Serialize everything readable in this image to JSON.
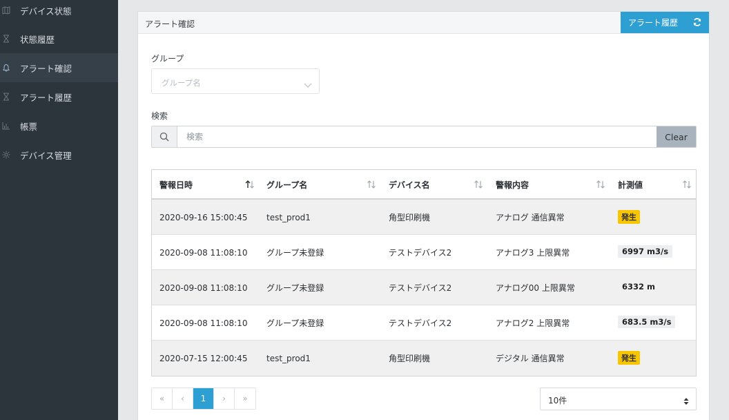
{
  "sidebar": {
    "items": [
      {
        "label": "デバイス状態",
        "icon": "map-icon"
      },
      {
        "label": "状態履歴",
        "icon": "hourglass-icon"
      },
      {
        "label": "アラート確認",
        "icon": "bell-icon",
        "active": true
      },
      {
        "label": "アラート履歴",
        "icon": "hourglass-icon"
      },
      {
        "label": "帳票",
        "icon": "bar-chart-icon"
      },
      {
        "label": "デバイス管理",
        "icon": "gear-icon"
      }
    ]
  },
  "panel": {
    "title": "アラート確認",
    "history_button": "アラート履歴"
  },
  "filters": {
    "group_label": "グループ",
    "group_placeholder": "グループ名",
    "search_label": "検索",
    "search_placeholder": "検索",
    "search_value": "",
    "clear_label": "Clear"
  },
  "table": {
    "columns": [
      "警報日時",
      "グループ名",
      "デバイス名",
      "警報内容",
      "計測値"
    ],
    "rows": [
      {
        "time": "2020-09-16 15:00:45",
        "group": "test_prod1",
        "device": "角型印刷機",
        "alert": "アナログ 通信異常",
        "value": "発生",
        "value_style": "yellow"
      },
      {
        "time": "2020-09-08 11:08:10",
        "group": "グループ未登録",
        "device": "テストデバイス2",
        "alert": "アナログ3 上限異常",
        "value": "6997 m3/s",
        "value_style": "gray"
      },
      {
        "time": "2020-09-08 11:08:10",
        "group": "グループ未登録",
        "device": "テストデバイス2",
        "alert": "アナログ00 上限異常",
        "value": "6332 m",
        "value_style": "plain"
      },
      {
        "time": "2020-09-08 11:08:10",
        "group": "グループ未登録",
        "device": "テストデバイス2",
        "alert": "アナログ2 上限異常",
        "value": "683.5 m3/s",
        "value_style": "gray"
      },
      {
        "time": "2020-07-15 12:00:45",
        "group": "test_prod1",
        "device": "角型印刷機",
        "alert": "デジタル 通信異常",
        "value": "発生",
        "value_style": "yellow"
      }
    ]
  },
  "pagination": {
    "first": "«",
    "prev": "‹",
    "current": "1",
    "next": "›",
    "last": "»",
    "per_page": "10件"
  },
  "colors": {
    "accent": "#2e9fd3",
    "sidebar_bg": "#2c343c",
    "badge_yellow": "#f7c600"
  }
}
